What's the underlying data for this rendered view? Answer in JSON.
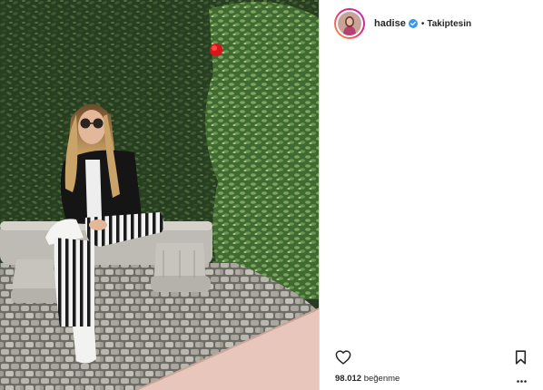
{
  "post": {
    "author": {
      "username": "hadise",
      "verified": true,
      "separator": "•",
      "follow_status": "Takiptesin"
    },
    "likes": {
      "count": "98.012",
      "word": "beğenme"
    },
    "icons": {
      "like": "heart-outline-icon",
      "save": "bookmark-outline-icon",
      "verified": "verified-badge-icon",
      "more": "more-options-icon"
    },
    "colors": {
      "verified_badge": "#3897f0",
      "text": "#262626",
      "avatar_ring": "#e5287b"
    }
  }
}
